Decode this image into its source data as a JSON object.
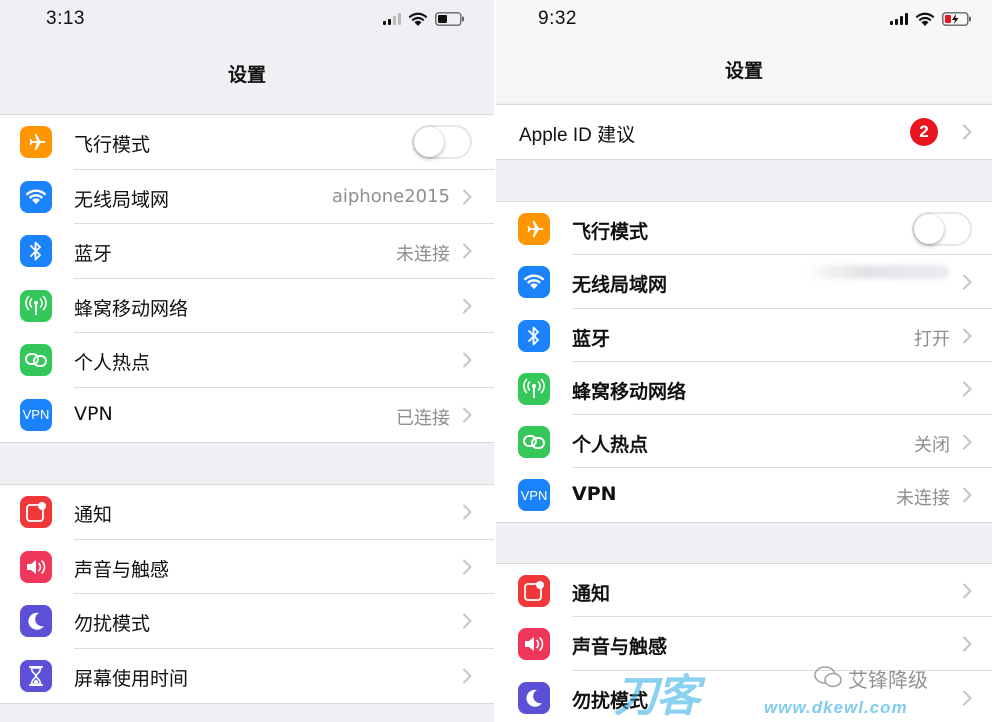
{
  "left": {
    "status": {
      "time": "3:13"
    },
    "title": "设置",
    "group1": [
      {
        "label": "飞行模式",
        "icon": "airplane-icon",
        "color": "#ff9500",
        "accessory": "toggle",
        "toggle_on": false
      },
      {
        "label": "无线局域网",
        "icon": "wifi-icon",
        "color": "#1a82fb",
        "value": "aiphone2015",
        "accessory": "chevron"
      },
      {
        "label": "蓝牙",
        "icon": "bluetooth-icon",
        "color": "#1a82fb",
        "value": "未连接",
        "accessory": "chevron"
      },
      {
        "label": "蜂窝移动网络",
        "icon": "cellular-antenna-icon",
        "color": "#34c759",
        "accessory": "chevron"
      },
      {
        "label": "个人热点",
        "icon": "hotspot-link-icon",
        "color": "#34c759",
        "accessory": "chevron"
      },
      {
        "label": "VPN",
        "icon": "vpn-icon",
        "color": "#1a82fb",
        "value": "已连接",
        "accessory": "chevron"
      }
    ],
    "group2": [
      {
        "label": "通知",
        "icon": "notification-icon",
        "color": "#f0373a",
        "accessory": "chevron"
      },
      {
        "label": "声音与触感",
        "icon": "speaker-icon",
        "color": "#f0365a",
        "accessory": "chevron"
      },
      {
        "label": "勿扰模式",
        "icon": "moon-icon",
        "color": "#5b50d6",
        "accessory": "chevron"
      },
      {
        "label": "屏幕使用时间",
        "icon": "hourglass-icon",
        "color": "#5b50d6",
        "accessory": "chevron"
      }
    ]
  },
  "right": {
    "status": {
      "time": "9:32"
    },
    "title": "设置",
    "apple_id": {
      "label": "Apple ID 建议",
      "badge": "2"
    },
    "group1": [
      {
        "label": "飞行模式",
        "icon": "airplane-icon",
        "color": "#ff9500",
        "accessory": "toggle",
        "toggle_on": false
      },
      {
        "label": "无线局域网",
        "icon": "wifi-icon",
        "color": "#1a82fb",
        "accessory": "chevron"
      },
      {
        "label": "蓝牙",
        "icon": "bluetooth-icon",
        "color": "#1a82fb",
        "value": "打开",
        "accessory": "chevron"
      },
      {
        "label": "蜂窝移动网络",
        "icon": "cellular-antenna-icon",
        "color": "#34c759",
        "accessory": "chevron"
      },
      {
        "label": "个人热点",
        "icon": "hotspot-link-icon",
        "color": "#34c759",
        "value": "关闭",
        "accessory": "chevron"
      },
      {
        "label": "VPN",
        "icon": "vpn-icon",
        "color": "#1a82fb",
        "value": "未连接",
        "accessory": "chevron"
      }
    ],
    "group2": [
      {
        "label": "通知",
        "icon": "notification-icon",
        "color": "#f0373a",
        "accessory": "chevron"
      },
      {
        "label": "声音与触感",
        "icon": "speaker-icon",
        "color": "#f0365a",
        "accessory": "chevron"
      },
      {
        "label": "勿扰模式",
        "icon": "moon-icon",
        "color": "#5b50d6",
        "accessory": "chevron"
      }
    ]
  },
  "watermark": {
    "wechat_name": "艾锋降级",
    "site_logo": "刀客",
    "site_url": "www.dkewl.com"
  },
  "colors": {
    "badge": "#e8141e",
    "separator": "#dcdce0",
    "value_text": "#8e8e93",
    "group_bg": "#efeff4"
  }
}
